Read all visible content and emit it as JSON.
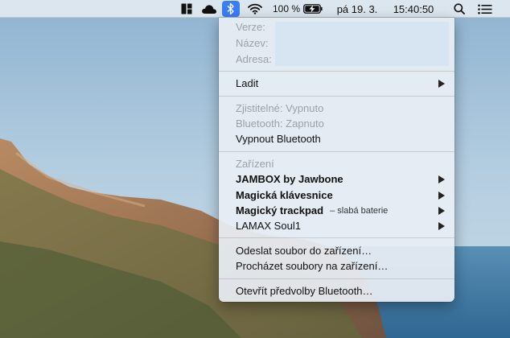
{
  "menubar": {
    "icons": [
      "window-layout-icon",
      "cloud-icon",
      "bluetooth-icon",
      "wifi-icon",
      "battery-charging-icon",
      "search-icon",
      "notification-center-icon"
    ],
    "battery_percent": "100 %",
    "date": "pá 19. 3.",
    "time": "15:40:50",
    "accent_color": "#3b7df5"
  },
  "bluetooth_menu": {
    "info": {
      "version_label": "Verze:",
      "name_label": "Název:",
      "address_label": "Adresa:"
    },
    "debug_label": "Ladit",
    "status": {
      "discoverable": "Zjistitelné: Vypnuto",
      "bluetooth": "Bluetooth: Zapnuto",
      "toggle": "Vypnout Bluetooth"
    },
    "devices_header": "Zařízení",
    "devices": [
      {
        "name": "JAMBOX by Jawbone",
        "bold": true,
        "note": ""
      },
      {
        "name": "Magická klávesnice",
        "bold": true,
        "note": ""
      },
      {
        "name": "Magický trackpad",
        "bold": true,
        "note": "– slabá baterie"
      },
      {
        "name": "LAMAX Soul1",
        "bold": false,
        "note": ""
      }
    ],
    "actions": {
      "send_file": "Odeslat soubor do zařízení…",
      "browse_files": "Procházet soubory na zařízení…"
    },
    "preferences": "Otevřít předvolby Bluetooth…"
  }
}
